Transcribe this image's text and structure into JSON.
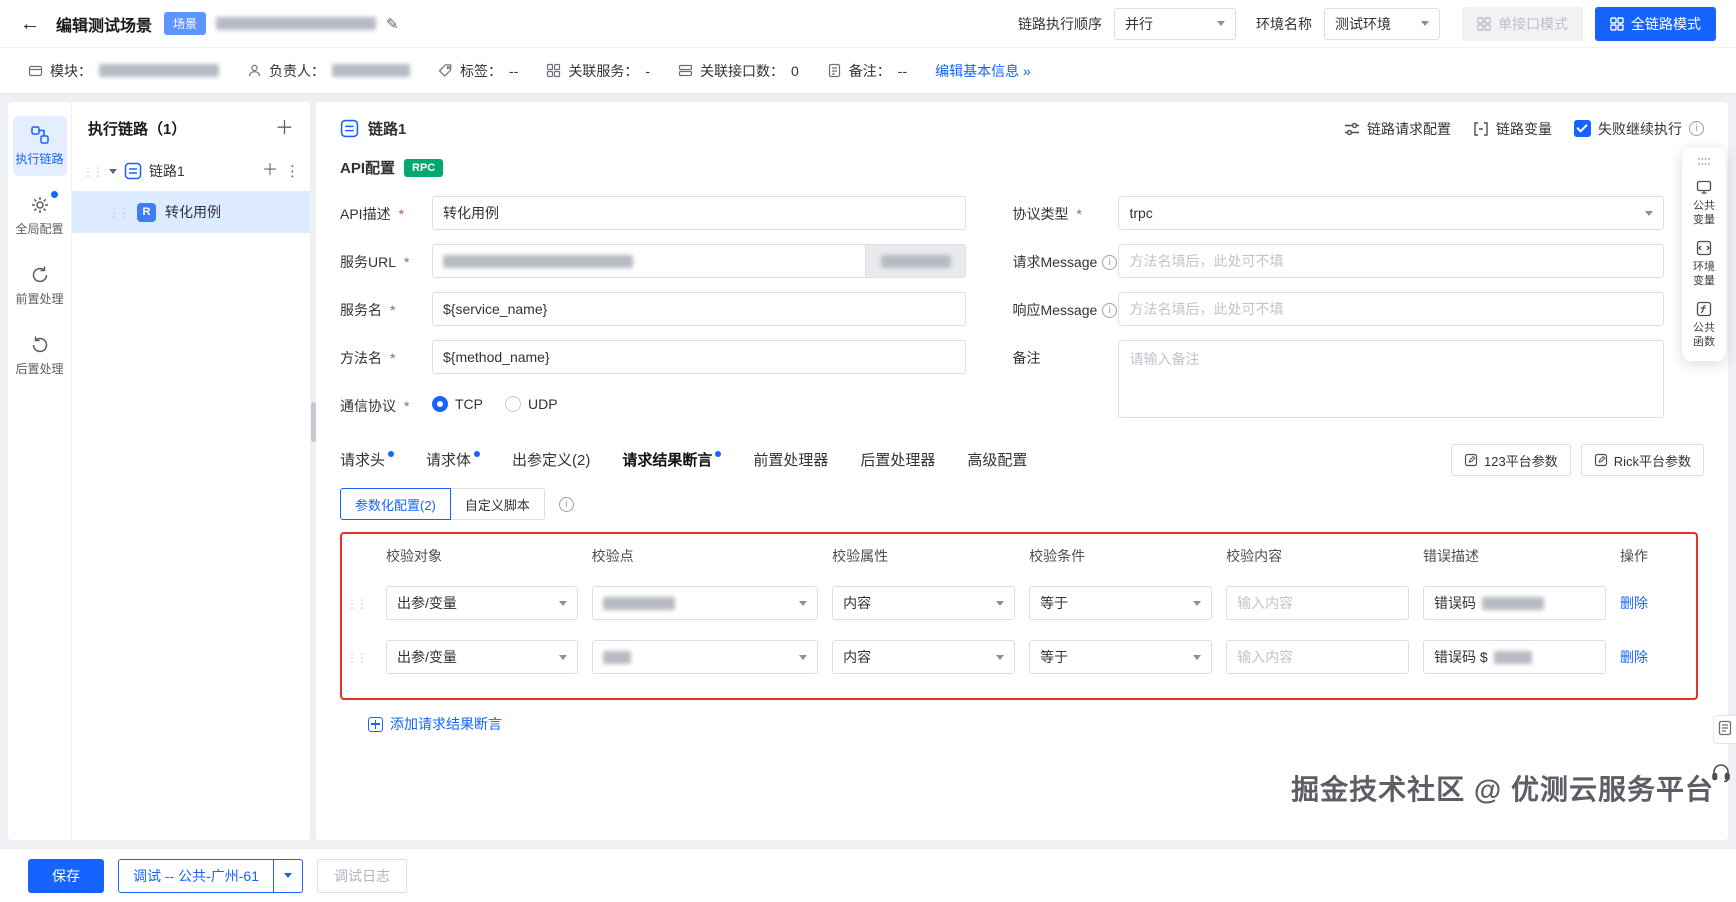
{
  "colors": {
    "primary": "#1664ff",
    "rpc_badge": "#00a870",
    "alert_border": "#e5302c",
    "scene_badge": "#5e96ff"
  },
  "header": {
    "title": "编辑测试场景",
    "scene_badge": "场景",
    "exec_order_label": "链路执行顺序",
    "exec_order_value": "并行",
    "env_name_label": "环境名称",
    "env_name_value": "测试环境",
    "single_mode_button": "单接口模式",
    "full_mode_button": "全链路模式"
  },
  "infobar": {
    "module_label": "模块：",
    "owner_label": "负责人：",
    "tags_label": "标签：",
    "tags_value": "--",
    "services_label": "关联服务：",
    "services_value": "-",
    "interfaces_label": "关联接口数：",
    "interfaces_value": "0",
    "remark_label": "备注：",
    "remark_value": "--",
    "edit_link": "编辑基本信息 »"
  },
  "rail": {
    "items": [
      {
        "label": "执行链路"
      },
      {
        "label": "全局配置"
      },
      {
        "label": "前置处理"
      },
      {
        "label": "后置处理"
      }
    ]
  },
  "tree": {
    "title": "执行链路（1）",
    "group_label": "链路1",
    "leaf_label": "转化用例",
    "leaf_icon": "R"
  },
  "main": {
    "chain_title": "链路1",
    "chain_request_config": "链路请求配置",
    "chain_variables": "链路变量",
    "continue_on_fail": "失败继续执行",
    "api_config_title": "API配置",
    "rpc_badge": "RPC",
    "form": {
      "api_desc_label": "API描述",
      "api_desc_value": "转化用例",
      "service_url_label": "服务URL",
      "service_name_label": "服务名",
      "service_name_value": "${service_name}",
      "method_name_label": "方法名",
      "method_name_value": "${method_name}",
      "comm_protocol_label": "通信协议",
      "tcp_label": "TCP",
      "udp_label": "UDP",
      "protocol_type_label": "协议类型",
      "protocol_type_value": "trpc",
      "request_message_label": "请求Message",
      "request_message_placeholder": "方法名填后，此处可不填",
      "response_message_label": "响应Message",
      "response_message_placeholder": "方法名填后，此处可不填",
      "remark_label": "备注",
      "remark_placeholder": "请输入备注"
    },
    "tabs": [
      {
        "label": "请求头"
      },
      {
        "label": "请求体"
      },
      {
        "label": "出参定义(2)"
      },
      {
        "label": "请求结果断言"
      },
      {
        "label": "前置处理器"
      },
      {
        "label": "后置处理器"
      },
      {
        "label": "高级配置"
      }
    ],
    "platform_param_buttons": [
      {
        "label": "123平台参数"
      },
      {
        "label": "Rick平台参数"
      }
    ],
    "subtabs": [
      {
        "label": "参数化配置(2)"
      },
      {
        "label": "自定义脚本"
      }
    ],
    "assert_table": {
      "headers": [
        "校验对象",
        "校验点",
        "校验属性",
        "校验条件",
        "校验内容",
        "错误描述",
        "操作"
      ],
      "rows": [
        {
          "target": "出参/变量",
          "attribute": "内容",
          "condition": "等于",
          "content_placeholder": "输入内容",
          "error_desc": "错误码",
          "delete_label": "删除"
        },
        {
          "target": "出参/变量",
          "attribute": "内容",
          "condition": "等于",
          "content_placeholder": "输入内容",
          "error_desc": "错误码 $",
          "delete_label": "删除"
        }
      ],
      "add_button": "添加请求结果断言"
    }
  },
  "side_toolbar": {
    "items": [
      {
        "line1": "公共",
        "line2": "变量"
      },
      {
        "line1": "环境",
        "line2": "变量"
      },
      {
        "line1": "公共",
        "line2": "函数"
      }
    ]
  },
  "footer": {
    "save_button": "保存",
    "debug_button": "调试 -- 公共-广州-61",
    "debug_log_button": "调试日志"
  },
  "watermark": "掘金技术社区 @ 优测云服务平台"
}
